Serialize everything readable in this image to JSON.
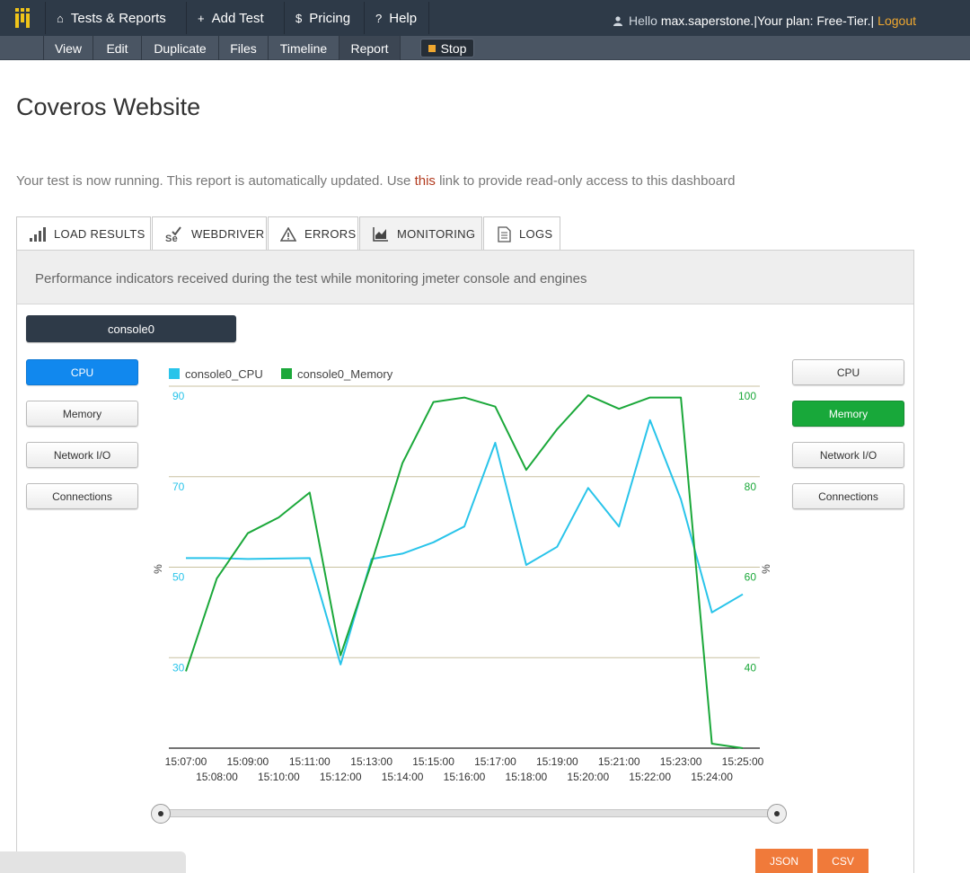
{
  "topnav": {
    "items": [
      {
        "icon": "home-icon",
        "glyph": "⌂",
        "label": "Tests & Reports"
      },
      {
        "icon": "plus-icon",
        "glyph": "+",
        "label": "Add Test"
      },
      {
        "icon": "dollar-icon",
        "glyph": "$",
        "label": "Pricing"
      },
      {
        "icon": "question-icon",
        "glyph": "?",
        "label": "Help"
      }
    ],
    "hello": "Hello",
    "username": "max.saperstone.",
    "plan": "|Your plan: Free-Tier.|",
    "logout": "Logout"
  },
  "subnav": {
    "items": [
      "View",
      "Edit",
      "Duplicate",
      "Files",
      "Timeline",
      "Report"
    ],
    "active": "Report",
    "stop_label": "Stop"
  },
  "page": {
    "title": "Coveros Website",
    "status_before": "Your test is now running. This report is automatically updated. Use ",
    "status_link": "this",
    "status_after": " link to provide read-only access to this dashboard"
  },
  "tabs": [
    "LOAD RESULTS",
    "WEBDRIVER",
    "ERRORS",
    "MONITORING",
    "LOGS"
  ],
  "active_tab": "MONITORING",
  "panel": {
    "description": "Performance indicators received during the test while monitoring jmeter console and engines",
    "console_label": "console0",
    "left_buttons": [
      "CPU",
      "Memory",
      "Network I/O",
      "Connections"
    ],
    "right_buttons": [
      "CPU",
      "Memory",
      "Network I/O",
      "Connections"
    ]
  },
  "export": {
    "json": "JSON",
    "csv": "CSV"
  },
  "colors": {
    "cpu": "#29c4ea",
    "memory": "#1ba83a",
    "nav": "#2e3a48",
    "accent": "#f07a3a",
    "grid": "#c8c1a0"
  },
  "chart_data": {
    "type": "line",
    "xlabels_top": [
      "15:07:00",
      "15:09:00",
      "15:11:00",
      "15:13:00",
      "15:15:00",
      "15:17:00",
      "15:19:00",
      "15:21:00",
      "15:23:00",
      "15:25:00"
    ],
    "xlabels_bottom": [
      "15:08:00",
      "15:10:00",
      "15:12:00",
      "15:14:00",
      "15:16:00",
      "15:18:00",
      "15:20:00",
      "15:22:00",
      "15:24:00"
    ],
    "x": [
      "15:07:00",
      "15:08:00",
      "15:09:00",
      "15:10:00",
      "15:11:00",
      "15:12:00",
      "15:13:00",
      "15:14:00",
      "15:15:00",
      "15:16:00",
      "15:17:00",
      "15:18:00",
      "15:19:00",
      "15:20:00",
      "15:21:00",
      "15:22:00",
      "15:23:00",
      "15:24:00",
      "15:25:00"
    ],
    "series": [
      {
        "name": "console0_CPU",
        "axis": "left",
        "values": [
          52,
          52,
          51.8,
          51.9,
          52,
          28.5,
          51.8,
          53,
          55.5,
          59,
          77.5,
          50.5,
          54.5,
          67.5,
          59,
          82.5,
          65,
          40,
          44
        ]
      },
      {
        "name": "console0_Memory",
        "axis": "right",
        "values": [
          37,
          57.5,
          67.5,
          71,
          76.5,
          40.5,
          61,
          83,
          96.5,
          97.5,
          95.5,
          81.5,
          90.5,
          98,
          95,
          97.5,
          97.5,
          21,
          20
        ]
      }
    ],
    "yleft": {
      "label": "%",
      "ticks": [
        30,
        50,
        70,
        90
      ],
      "range": [
        10,
        90
      ]
    },
    "yright": {
      "label": "%",
      "ticks": [
        40,
        60,
        80,
        100
      ],
      "range": [
        20,
        100
      ]
    },
    "legend": "top-left",
    "grid": true
  }
}
